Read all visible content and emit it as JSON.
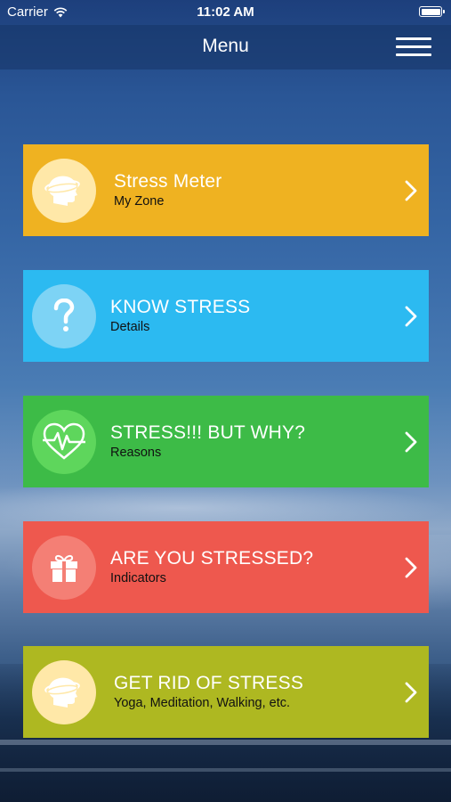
{
  "status_bar": {
    "carrier": "Carrier",
    "time": "11:02 AM",
    "wifi_icon": "wifi-icon",
    "battery_icon": "battery-icon"
  },
  "nav": {
    "title": "Menu",
    "menu_icon": "hamburger-menu-icon"
  },
  "menu_items": [
    {
      "title": "Stress Meter",
      "subtitle": "My Zone",
      "icon": "head-icon",
      "color": "#EFB221",
      "icon_bg": "#FFE8A8"
    },
    {
      "title": "KNOW STRESS",
      "subtitle": "Details",
      "icon": "question-mark-icon",
      "color": "#2CBAF1",
      "icon_bg": "#7DD3F5"
    },
    {
      "title": "STRESS!!! BUT WHY?",
      "subtitle": "Reasons",
      "icon": "heartbeat-icon",
      "color": "#3DBB47",
      "icon_bg": "#5ED65C"
    },
    {
      "title": "ARE YOU STRESSED?",
      "subtitle": "Indicators",
      "icon": "gift-icon",
      "color": "#EE584E",
      "icon_bg": "#F47F75"
    },
    {
      "title": "GET RID OF STRESS",
      "subtitle": "Yoga, Meditation, Walking, etc.",
      "icon": "head-icon",
      "color": "#AEB821",
      "icon_bg": "#FFE8A8"
    }
  ]
}
